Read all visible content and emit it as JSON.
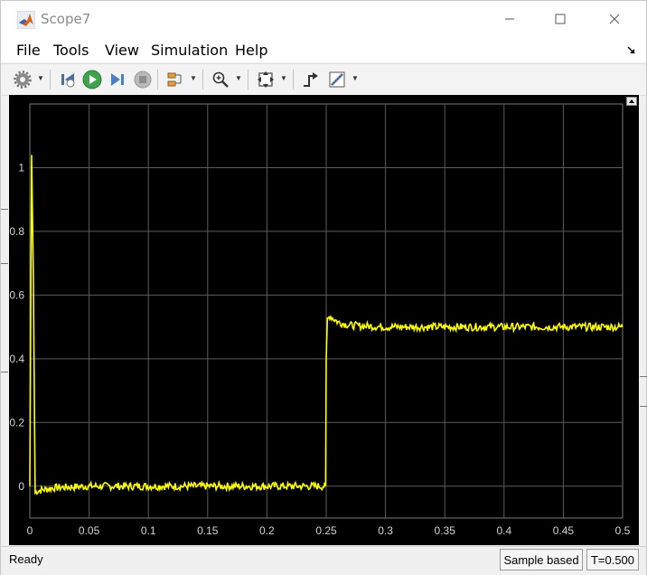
{
  "window": {
    "title": "Scope7"
  },
  "menu": {
    "items": [
      "File",
      "Tools",
      "View",
      "Simulation",
      "Help"
    ]
  },
  "toolbar": {
    "icons": [
      "gear-icon",
      "step-back-icon",
      "run-icon",
      "step-forward-icon",
      "stop-icon",
      "configure-blocks-icon",
      "zoom-icon",
      "fit-axes-icon",
      "triggers-icon",
      "measurements-icon"
    ]
  },
  "status": {
    "ready": "Ready",
    "sample_mode": "Sample based",
    "time": "T=0.500"
  },
  "colors": {
    "plot_background": "#000000",
    "signal": "#ffff00",
    "grid": "#5c5c5c",
    "tick_label": "#d4d4d4"
  },
  "chart_data": {
    "type": "line",
    "title": "",
    "xlabel": "",
    "ylabel": "",
    "xlim": [
      0,
      0.5
    ],
    "ylim": [
      -0.1,
      1.2
    ],
    "xticks": [
      0,
      0.05,
      0.1,
      0.15,
      0.2,
      0.25,
      0.3,
      0.35,
      0.4,
      0.45,
      0.5
    ],
    "xtick_labels": [
      "0",
      "0.05",
      "0.1",
      "0.15",
      "0.2",
      "0.25",
      "0.3",
      "0.35",
      "0.4",
      "0.45",
      "0.5"
    ],
    "yticks": [
      0,
      0.2,
      0.4,
      0.6,
      0.8,
      1
    ],
    "ytick_labels": [
      "0",
      "0.2",
      "0.4",
      "0.6",
      "0.8",
      "1"
    ],
    "grid": true,
    "series": [
      {
        "values_xy": [
          [
            0,
            0
          ],
          [
            0.0015,
            1.04
          ],
          [
            0.003,
            0.65
          ],
          [
            0.0045,
            -0.02
          ],
          [
            0.006,
            -0.015
          ],
          [
            0.02,
            -0.005
          ],
          [
            0.05,
            0
          ],
          [
            0.1,
            0
          ],
          [
            0.15,
            0
          ],
          [
            0.2,
            0
          ],
          [
            0.248,
            0
          ],
          [
            0.2495,
            0.0
          ],
          [
            0.25,
            0.4
          ],
          [
            0.251,
            0.52
          ],
          [
            0.253,
            0.535
          ],
          [
            0.26,
            0.515
          ],
          [
            0.27,
            0.505
          ],
          [
            0.3,
            0.5
          ],
          [
            0.35,
            0.5
          ],
          [
            0.4,
            0.5
          ],
          [
            0.45,
            0.5
          ],
          [
            0.5,
            0.5
          ]
        ],
        "noise_amplitude": 0.012
      }
    ]
  }
}
